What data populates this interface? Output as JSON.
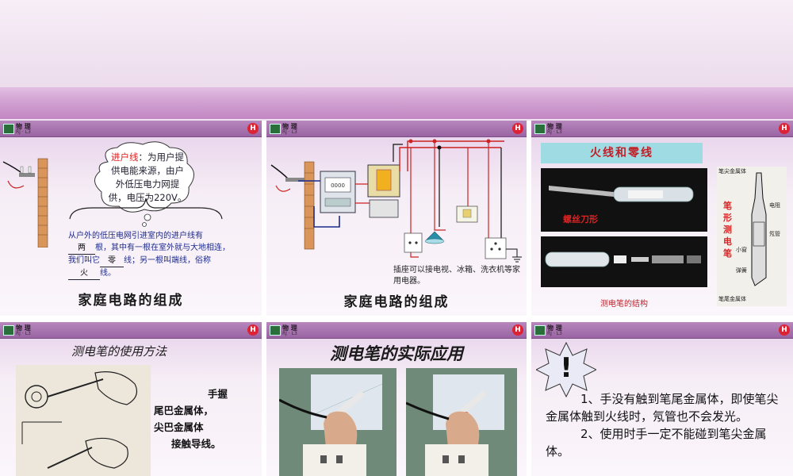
{
  "header": {
    "subject": "物 理",
    "code": "RJ · L3",
    "badge": "H"
  },
  "slide1": {
    "bubble": {
      "label": "进户线",
      "rest": "：为用户提供电能来源，由户外低压电力网提供，电压为",
      "voltage": "220V",
      "end": "。"
    },
    "sentence": {
      "p1": "从户外的低压电网引进室内的进户线有",
      "blank1": "两",
      "p2": "根，其中有一根在室外就与大地相连，我们叫它",
      "blank2": "零",
      "p3": "线；另一根叫端线，俗称",
      "blank3": "火",
      "p4": "线。"
    },
    "title": "家庭电路的组成"
  },
  "slide2": {
    "caption": "插座可以接电视、冰箱、洗衣机等家用电器。",
    "title": "家庭电路的组成"
  },
  "slide3": {
    "banner": "火线和零线",
    "photo_label": "螺丝刀形",
    "side_top": "笔尖金属体",
    "side_vertical": "笔形测电笔",
    "side_labels": [
      "电阻",
      "氖管",
      "小窗",
      "弹簧"
    ],
    "side_bottom": "笔尾金属体",
    "caption": "测电笔的结构"
  },
  "slide4": {
    "title": "测电笔的使用方法",
    "lines": [
      "手握",
      "尾巴金属体，",
      "尖巴金属体",
      "接触导线。"
    ]
  },
  "slide5": {
    "title": "测电笔的实际应用"
  },
  "slide6": {
    "mark": "!",
    "p1": "1、手没有触到笔尾金属体，即使笔尖金属体触到火线时，氖管也不会发光。",
    "p2": "2、使用时手一定不能碰到笔尖金属体。"
  },
  "colors": {
    "bar": "#c387c3",
    "slide_header": "#9a64a3",
    "title_red": "#c0202a",
    "text_blue": "#1e2a8a"
  }
}
